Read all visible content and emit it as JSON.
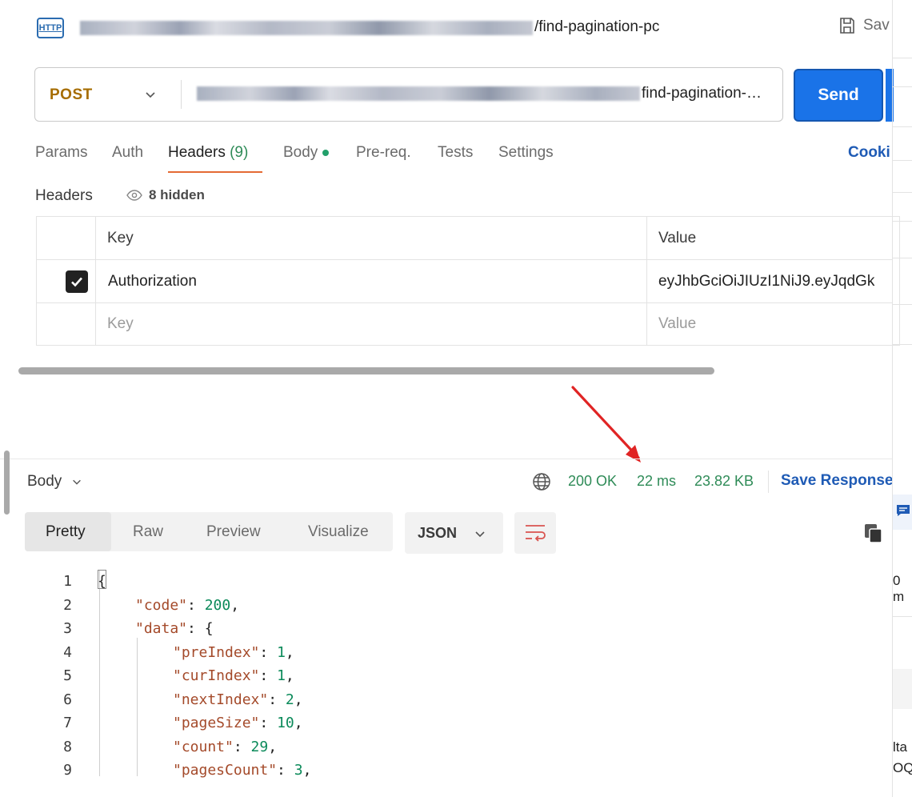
{
  "request": {
    "icon_label": "HTTP",
    "title_suffix": "/find-pagination-pc",
    "save_label": "Sav",
    "method": "POST",
    "url_suffix": "find-pagination-…",
    "send_label": "Send"
  },
  "tabs": {
    "params": "Params",
    "auth": "Auth",
    "headers": "Headers",
    "headers_count": "(9)",
    "body": "Body",
    "prereq": "Pre-req.",
    "tests": "Tests",
    "settings": "Settings",
    "cookies": "Cooki"
  },
  "headers_section": {
    "label": "Headers",
    "hidden": "8 hidden",
    "col_key": "Key",
    "col_value": "Value",
    "rows": [
      {
        "key": "Authorization",
        "value": "eyJhbGciOiJIUzI1NiJ9.eyJqdGk",
        "checked": true
      }
    ],
    "placeholder_key": "Key",
    "placeholder_value": "Value"
  },
  "response": {
    "body_label": "Body",
    "status": "200 OK",
    "time": "22 ms",
    "size": "23.82 KB",
    "save_response": "Save Response",
    "view_tabs": [
      "Pretty",
      "Raw",
      "Preview",
      "Visualize"
    ],
    "format": "JSON",
    "lines": [
      {
        "n": "1",
        "indent": 0,
        "text": "{"
      },
      {
        "n": "2",
        "indent": 1,
        "key": "\"code\"",
        "sep": ": ",
        "val": "200",
        "tail": ","
      },
      {
        "n": "3",
        "indent": 1,
        "key": "\"data\"",
        "sep": ": ",
        "val": "",
        "tail": "{"
      },
      {
        "n": "4",
        "indent": 2,
        "key": "\"preIndex\"",
        "sep": ": ",
        "val": "1",
        "tail": ","
      },
      {
        "n": "5",
        "indent": 2,
        "key": "\"curIndex\"",
        "sep": ": ",
        "val": "1",
        "tail": ","
      },
      {
        "n": "6",
        "indent": 2,
        "key": "\"nextIndex\"",
        "sep": ": ",
        "val": "2",
        "tail": ","
      },
      {
        "n": "7",
        "indent": 2,
        "key": "\"pageSize\"",
        "sep": ": ",
        "val": "10",
        "tail": ","
      },
      {
        "n": "8",
        "indent": 2,
        "key": "\"count\"",
        "sep": ": ",
        "val": "29",
        "tail": ","
      },
      {
        "n": "9",
        "indent": 2,
        "key": "\"pagesCount\"",
        "sep": ": ",
        "val": "3",
        "tail": ","
      }
    ]
  },
  "side_pane": {
    "text_1": "0 m",
    "text_2": "lta",
    "text_3": "OQ"
  },
  "colors": {
    "accent": "#1a73e8",
    "method": "#a66d00",
    "status": "#2e8b57",
    "annotation_arrow": "#e02424"
  }
}
